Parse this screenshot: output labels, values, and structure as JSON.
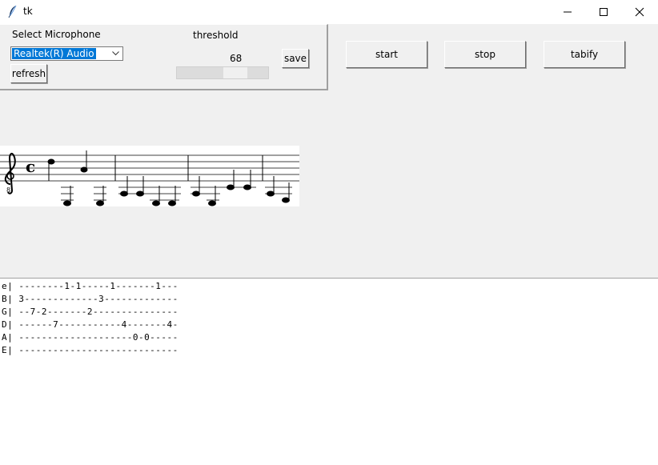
{
  "window": {
    "title": "tk",
    "icons": [
      "feather-icon",
      "minimize-icon",
      "maximize-icon",
      "close-icon"
    ]
  },
  "mic_panel": {
    "label": "Select Microphone",
    "selected_device": "Realtek(R) Audio",
    "refresh_label": "refresh",
    "threshold_label": "threshold",
    "threshold_value": "68",
    "threshold_fraction": 0.68,
    "save_label": "save"
  },
  "controls": {
    "start_label": "start",
    "stop_label": "stop",
    "tabify_label": "tabify"
  },
  "notation": {
    "clef": "treble-8vb",
    "time_signature": "common-time"
  },
  "tablature": [
    "e| --------1-1-----1-------1---",
    "B| 3-------------3-------------",
    "G| --7-2-------2---------------",
    "D| ------7-----------4-------4-",
    "A| --------------------0-0-----",
    "E| ----------------------------"
  ]
}
